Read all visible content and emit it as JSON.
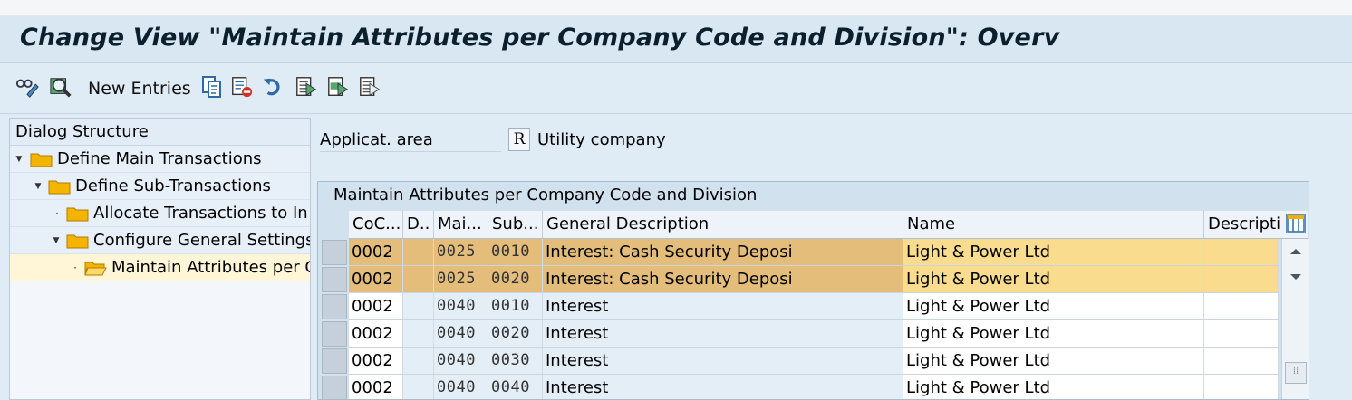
{
  "title": "Change View \"Maintain Attributes per Company Code and Division\": Overv",
  "toolbar": {
    "new_entries_label": "New Entries",
    "icons": [
      "glasses-pencil-icon",
      "find-icon",
      "copy-icon",
      "delete-icon",
      "undo-icon",
      "select-all-icon",
      "select-block-icon",
      "deselect-all-icon"
    ]
  },
  "tree": {
    "header": "Dialog Structure",
    "items": [
      {
        "label": "Define Main Transactions",
        "level": 0,
        "expanded": true,
        "selected": false
      },
      {
        "label": "Define Sub-Transactions",
        "level": 1,
        "expanded": true,
        "selected": false
      },
      {
        "label": "Allocate Transactions to In",
        "level": 2,
        "expanded": false,
        "selected": false
      },
      {
        "label": "Configure General Settings",
        "level": 2,
        "expanded": true,
        "selected": false
      },
      {
        "label": "Maintain Attributes per C",
        "level": 3,
        "expanded": false,
        "selected": true
      }
    ]
  },
  "application_area": {
    "label": "Applicat. area",
    "value": "R",
    "description": "Utility company"
  },
  "table": {
    "title": "Maintain Attributes per Company Code and Division",
    "columns": [
      "CoC...",
      "D..",
      "Mai...",
      "Sub...",
      "General Description",
      "Name",
      "Descripti"
    ],
    "rows": [
      {
        "coc": "0002",
        "d": "",
        "main": "0025",
        "sub": "0010",
        "gen_desc": "Interest: Cash Security Deposi",
        "name": "Light & Power Ltd",
        "descr": "",
        "highlighted": true
      },
      {
        "coc": "0002",
        "d": "",
        "main": "0025",
        "sub": "0020",
        "gen_desc": "Interest: Cash Security Deposi",
        "name": "Light & Power Ltd",
        "descr": "",
        "highlighted": true
      },
      {
        "coc": "0002",
        "d": "",
        "main": "0040",
        "sub": "0010",
        "gen_desc": "Interest",
        "name": "Light & Power Ltd",
        "descr": "",
        "highlighted": false
      },
      {
        "coc": "0002",
        "d": "",
        "main": "0040",
        "sub": "0020",
        "gen_desc": "Interest",
        "name": "Light & Power Ltd",
        "descr": "",
        "highlighted": false
      },
      {
        "coc": "0002",
        "d": "",
        "main": "0040",
        "sub": "0030",
        "gen_desc": "Interest",
        "name": "Light & Power Ltd",
        "descr": "",
        "highlighted": false
      },
      {
        "coc": "0002",
        "d": "",
        "main": "0040",
        "sub": "0040",
        "gen_desc": "Interest",
        "name": "Light & Power Ltd",
        "descr": "",
        "highlighted": false
      }
    ]
  },
  "colors": {
    "highlight_row": "#e3bd79",
    "highlight_name": "#f9dc8d",
    "folder": "#f5b400",
    "title_bg": "#d9e7f3"
  }
}
